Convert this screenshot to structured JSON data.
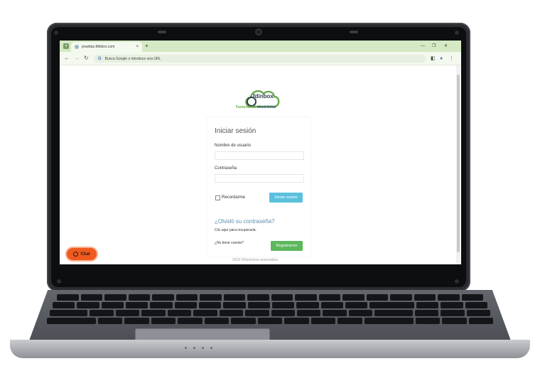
{
  "browser": {
    "tab_title": "pruebas.fdinbox.com",
    "tab_close": "×",
    "new_tab": "+",
    "omnibox_placeholder": "Busca Google o introduce una URL",
    "google_letter": "G",
    "window_controls": [
      "⌄",
      "—",
      "❐",
      "✕"
    ]
  },
  "brand": {
    "name": "fdinbox",
    "tagline_part1": "Facturación",
    "tagline_part2": "electrónica",
    "cloud_color": "#6aa84f"
  },
  "login": {
    "title": "Iniciar sesión",
    "username_label": "Nombre de usuario",
    "username_value": "",
    "password_label": "Contraseña",
    "password_value": "",
    "remember_label": "Recordarme",
    "remember_checked": false,
    "login_button": "Iniciar sesión",
    "forgot_title": "¿Olvidó su contraseña?",
    "forgot_link_prefix": "Clic ",
    "forgot_link": "aquí",
    "forgot_link_suffix": " para recuperarla.",
    "no_account": "¿No tiene cuenta?",
    "register_button": "Registrarme",
    "login_color": "#5bc0de",
    "register_color": "#5cb85c"
  },
  "footer": {
    "text": "2015 ©Derechos reservados."
  },
  "chat": {
    "label": "Chat",
    "color": "#f05a1e"
  }
}
